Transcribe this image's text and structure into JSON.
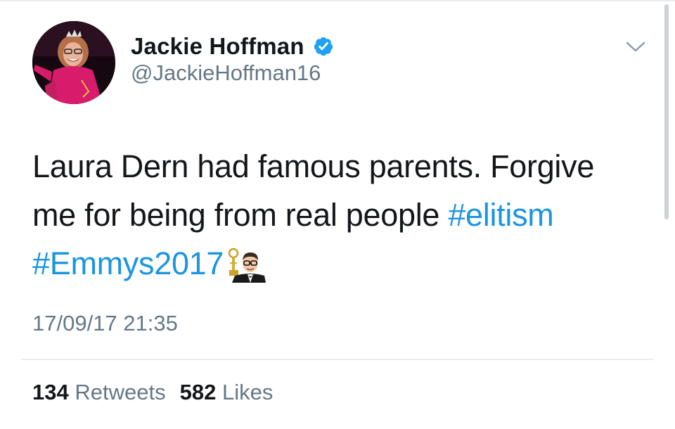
{
  "author": {
    "name": "Jackie Hoffman",
    "handle": "@JackieHoffman16",
    "verified": true,
    "verified_icon": "verified-badge-icon"
  },
  "menu_icon": "chevron-down-icon",
  "tweet": {
    "line1": "Laura Dern had famous parents. Forgive",
    "line2_text": "me for being from real people ",
    "hashtag_elitism": "#elitism",
    "hashtag_emmys": "#Emmys2017",
    "emoji": "emmys-hashflag-emoji"
  },
  "timestamp": "17/09/17 21:35",
  "stats": {
    "retweets_count": "134",
    "retweets_label": "Retweets",
    "likes_count": "582",
    "likes_label": "Likes"
  },
  "colors": {
    "hashtag": "#1b95e0",
    "secondary_text": "#657786",
    "primary_text": "#14171a",
    "verified": "#1da1f2"
  }
}
